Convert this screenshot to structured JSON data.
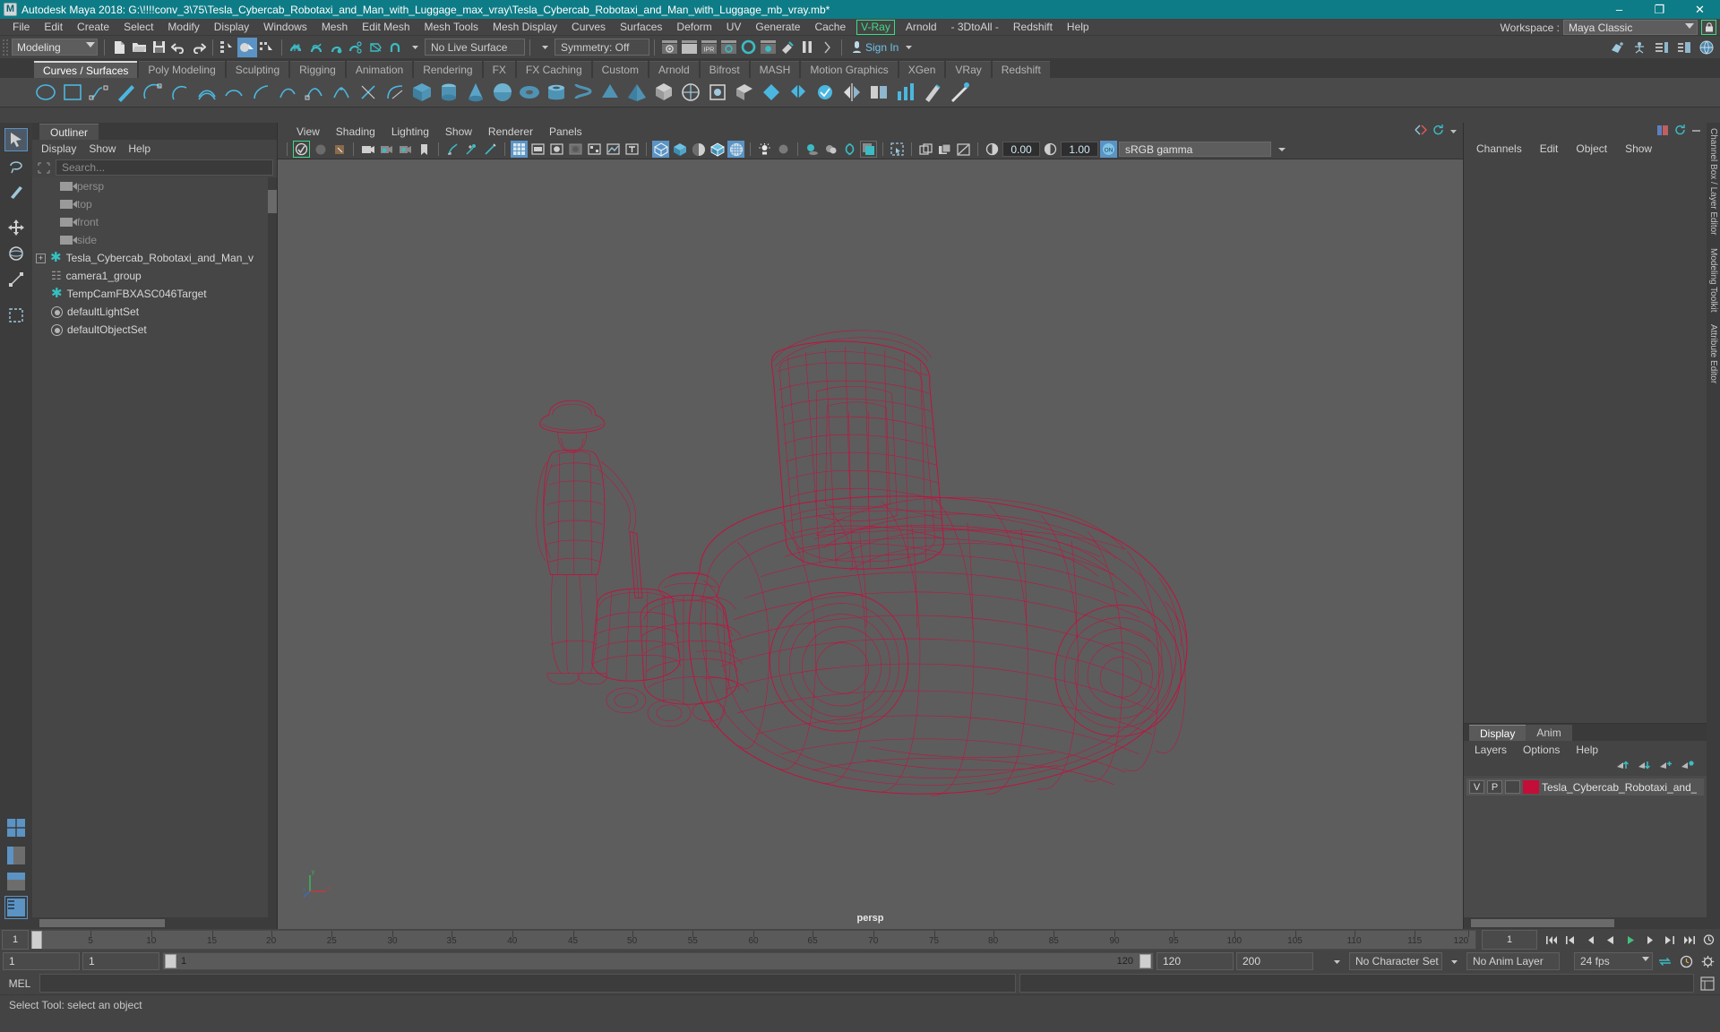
{
  "window": {
    "title": "Autodesk Maya 2018: G:\\!!!!conv_3\\75\\Tesla_Cybercab_Robotaxi_and_Man_with_Luggage_max_vray\\Tesla_Cybercab_Robotaxi_and_Man_with_Luggage_mb_vray.mb*",
    "minimize": "–",
    "maximize": "❐",
    "close": "✕",
    "app_badge": "M"
  },
  "menubar": {
    "items": [
      "File",
      "Edit",
      "Create",
      "Select",
      "Modify",
      "Display",
      "Windows",
      "Mesh",
      "Edit Mesh",
      "Mesh Tools",
      "Mesh Display",
      "Curves",
      "Surfaces",
      "Deform",
      "UV",
      "Generate",
      "Cache"
    ],
    "highlight_item": "V-Ray",
    "items_after": [
      "Arnold",
      "- 3DtoAll -",
      "Redshift",
      "Help"
    ],
    "workspace_label": "Workspace :",
    "workspace_value": "Maya Classic",
    "lock_icon": "lock-icon"
  },
  "statusline": {
    "mode": "Modeling",
    "live_surface": "No Live Surface",
    "symmetry": "Symmetry: Off",
    "sign_in": "Sign In"
  },
  "shelf": {
    "tabs": [
      "Curves / Surfaces",
      "Poly Modeling",
      "Sculpting",
      "Rigging",
      "Animation",
      "Rendering",
      "FX",
      "FX Caching",
      "Custom",
      "Arnold",
      "Bifrost",
      "MASH",
      "Motion Graphics",
      "XGen",
      "VRay",
      "Redshift"
    ],
    "active_tab": "Curves / Surfaces"
  },
  "outliner": {
    "tab": "Outliner",
    "menus": [
      "Display",
      "Show",
      "Help"
    ],
    "search_placeholder": "Search...",
    "items": [
      {
        "label": "persp",
        "icon": "camera-icon",
        "dim": true,
        "expand": false
      },
      {
        "label": "top",
        "icon": "camera-icon",
        "dim": true,
        "expand": false
      },
      {
        "label": "front",
        "icon": "camera-icon",
        "dim": true,
        "expand": false
      },
      {
        "label": "side",
        "icon": "camera-icon",
        "dim": true,
        "expand": false
      },
      {
        "label": "Tesla_Cybercab_Robotaxi_and_Man_v",
        "icon": "transform-icon",
        "dim": false,
        "expand": true
      },
      {
        "label": "camera1_group",
        "icon": "group-icon",
        "dim": false,
        "expand": false
      },
      {
        "label": "TempCamFBXASC046Target",
        "icon": "transform-icon",
        "dim": false,
        "expand": false
      },
      {
        "label": "defaultLightSet",
        "icon": "set-icon",
        "dim": false,
        "expand": false
      },
      {
        "label": "defaultObjectSet",
        "icon": "set-icon",
        "dim": false,
        "expand": false
      }
    ]
  },
  "viewport": {
    "menus": [
      "View",
      "Shading",
      "Lighting",
      "Show",
      "Renderer",
      "Panels"
    ],
    "exposure": "0.00",
    "gamma_value": "1.00",
    "color_management": "sRGB gamma",
    "camera_label": "persp",
    "axis_labels": {
      "x": "x",
      "y": "y",
      "z": "z"
    },
    "model_color": "#c2123f",
    "background_color": "#5d5d5d"
  },
  "channelbox": {
    "tabs_vertical": [
      "Channel Box / Layer Editor",
      "Modeling Toolkit",
      "Attribute Editor"
    ],
    "menus": [
      "Channels",
      "Edit",
      "Object",
      "Show"
    ]
  },
  "layer_editor": {
    "tabs": [
      "Display",
      "Anim"
    ],
    "active_tab": "Display",
    "menus": [
      "Layers",
      "Options",
      "Help"
    ],
    "layer": {
      "visibility": "V",
      "playback": "P",
      "name": "Tesla_Cybercab_Robotaxi_and_",
      "color": "#c20e38"
    }
  },
  "timeline": {
    "current_frame_left": "1",
    "current_frame_right": "1",
    "tick_labels": [
      "5",
      "10",
      "15",
      "20",
      "25",
      "30",
      "35",
      "40",
      "45",
      "50",
      "55",
      "60",
      "65",
      "70",
      "75",
      "80",
      "85",
      "90",
      "95",
      "100",
      "105",
      "110",
      "115",
      "120"
    ],
    "range_start": "1",
    "range_end": "120",
    "anim_start": "1",
    "anim_end": "120",
    "playback_start": "1",
    "playback_end": "120",
    "scene_end": "200",
    "character_set": "No Character Set",
    "anim_layer": "No Anim Layer",
    "fps": "24 fps"
  },
  "command_line": {
    "label": "MEL",
    "input_value": ""
  },
  "status_bar": {
    "message": "Select Tool: select an object"
  }
}
